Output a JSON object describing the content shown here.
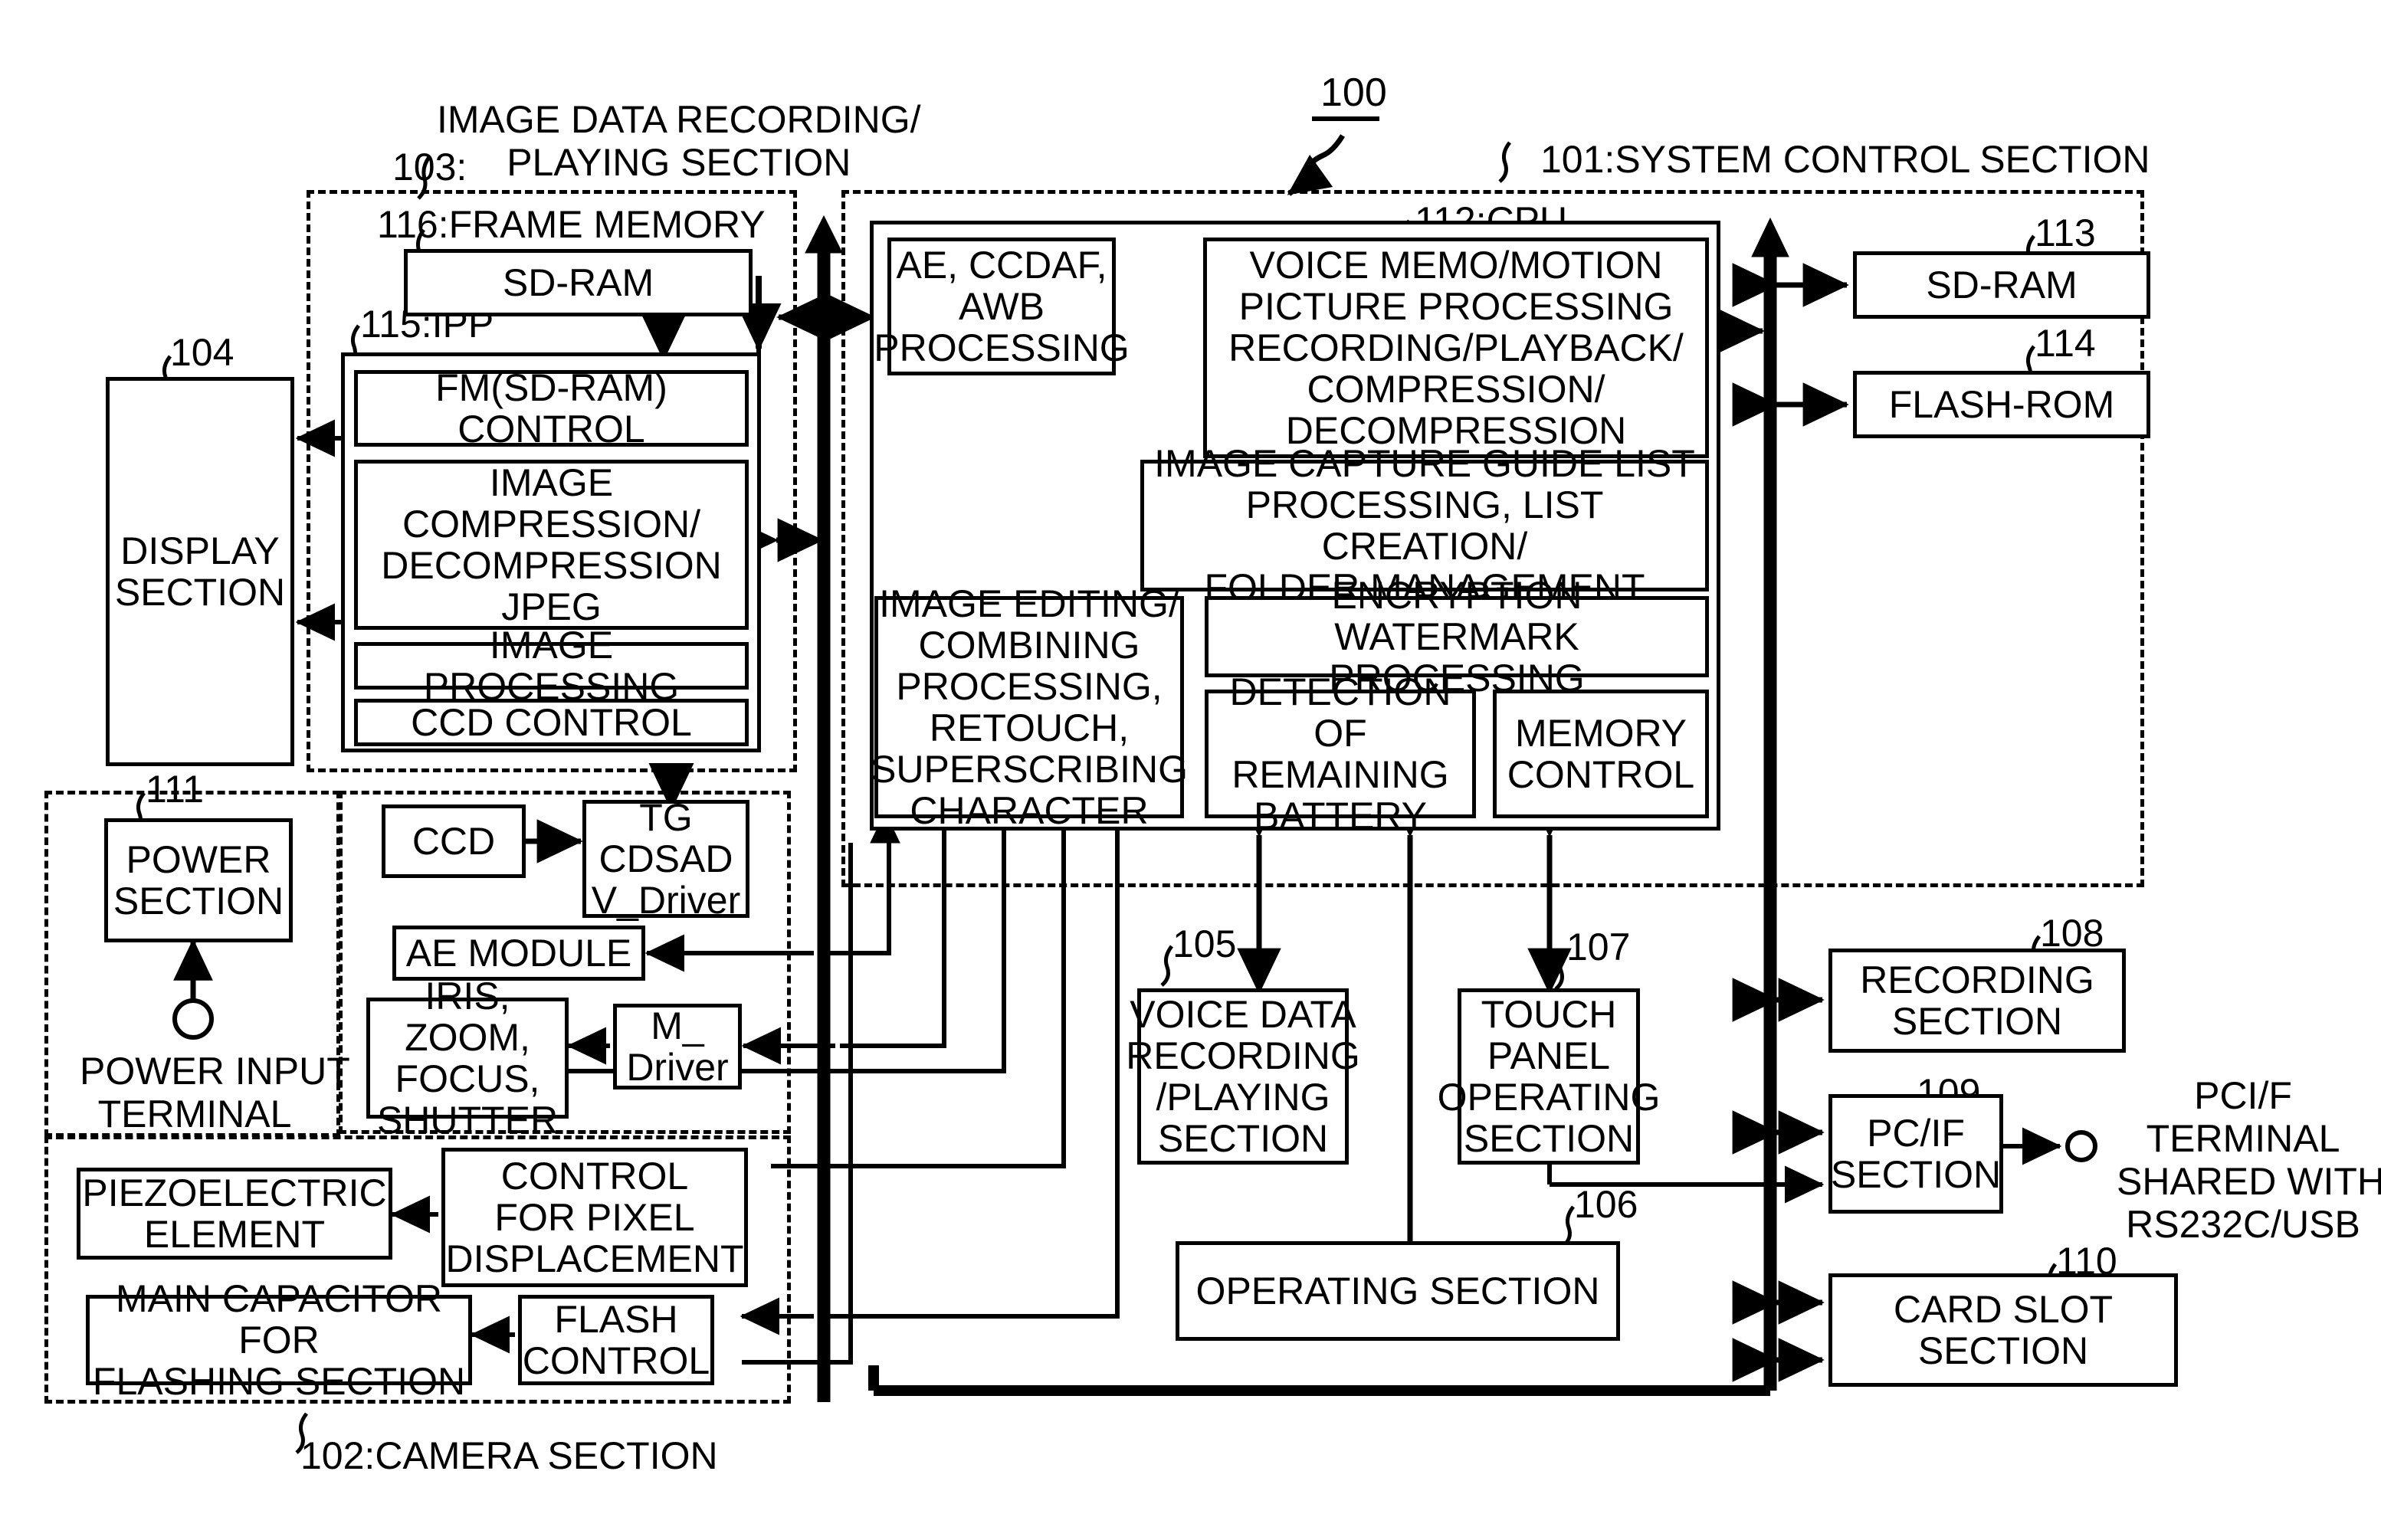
{
  "figure": {
    "ref_100": "100",
    "title_image_data_recording": "IMAGE DATA RECORDING/\nPLAYING SECTION",
    "ref_103": "103:",
    "label_system_control": "101:SYSTEM CONTROL SECTION",
    "label_frame_memory": "116:FRAME MEMORY",
    "label_ipp": "115:IPP",
    "label_cpu": "112:CPU",
    "label_camera_section": "102:CAMERA SECTION",
    "ref_104": "104",
    "ref_105": "105",
    "ref_106": "106",
    "ref_107": "107",
    "ref_108": "108",
    "ref_109": "109",
    "ref_110": "110",
    "ref_111": "111",
    "ref_113": "113",
    "ref_114": "114"
  },
  "boxes": {
    "sdram_frame": "SD-RAM",
    "fm_control": "FM(SD-RAM)\nCONTROL",
    "image_compression": "IMAGE\nCOMPRESSION/\nDECOMPRESSION\nJPEG",
    "image_processing": "IMAGE PROCESSING",
    "ccd_control": "CCD CONTROL",
    "display_section": "DISPLAY\nSECTION",
    "power_section": "POWER\nSECTION",
    "power_input_terminal": "POWER INPUT\nTERMINAL",
    "ccd": "CCD",
    "tg_cdsad": "TG\nCDSAD\nV_Driver",
    "ae_module": "AE MODULE",
    "iris_zoom": "IRIS, ZOOM,\nFOCUS,\nSHUTTER",
    "m_driver": "M_\nDriver",
    "piezoelectric": "PIEZOELECTRIC\nELEMENT",
    "control_pixel_displacement": "CONTROL\nFOR PIXEL\nDISPLACEMENT",
    "main_capacitor": "MAIN CAPACITOR FOR\nFLASHING SECTION",
    "flash_control": "FLASH\nCONTROL",
    "ae_ccdaf_awb": "AE, CCDAF,\nAWB\nPROCESSING",
    "voice_memo": "VOICE MEMO/MOTION\nPICTURE PROCESSING\nRECORDING/PLAYBACK/\nCOMPRESSION/\nDECOMPRESSION",
    "image_capture_guide": "IMAGE CAPTURE GUIDE LIST\nPROCESSING, LIST CREATION/\nFOLDER MANAGEMENT",
    "image_editing": "IMAGE EDITING/\nCOMBINING\nPROCESSING,\nRETOUCH,\nSUPERSCRIBING\nCHARACTER",
    "encryption_watermark": "ENCRYPTION WATERMARK\nPROCESSING",
    "detection_battery": "DETECTION OF\nREMAINING\nBATTERY",
    "memory_control": "MEMORY\nCONTROL",
    "voice_data_recording": "VOICE DATA\nRECORDING\n/PLAYING\nSECTION",
    "touch_panel": "TOUCH\nPANEL\nOPERATING\nSECTION",
    "operating_section": "OPERATING SECTION",
    "sdram_sys": "SD-RAM",
    "flash_rom": "FLASH-ROM",
    "recording_section": "RECORDING\nSECTION",
    "pc_if_section": "PC/IF\nSECTION",
    "pcif_terminal": "PCI/F\nTERMINAL\nSHARED WITH\nRS232C/USB",
    "card_slot_section": "CARD SLOT\nSECTION"
  },
  "colors": {
    "line": "#000000",
    "background": "#ffffff"
  }
}
